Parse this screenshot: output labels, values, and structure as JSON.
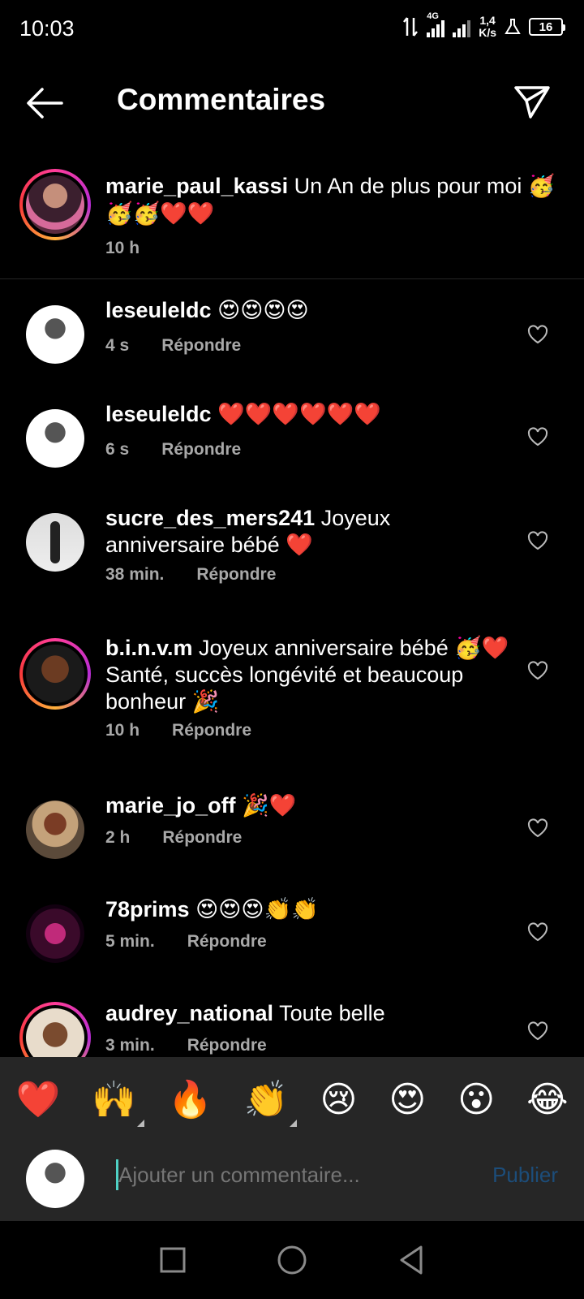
{
  "status_bar": {
    "time": "10:03",
    "network": "4G",
    "speed_value": "1,4",
    "speed_unit": "K/s",
    "battery": "16"
  },
  "header": {
    "title": "Commentaires"
  },
  "caption": {
    "username": "marie_paul_kassi",
    "text": "Un An de plus pour moi 🥳🥳🥳❤️❤️",
    "time": "10 h"
  },
  "comments": [
    {
      "username": "leseuleldc",
      "text": "😍😍😍😍",
      "time": "4 s",
      "reply": "Répondre"
    },
    {
      "username": "leseuleldc",
      "text": "❤️❤️❤️❤️❤️❤️",
      "time": "6 s",
      "reply": "Répondre"
    },
    {
      "username": "sucre_des_mers241",
      "text": "Joyeux anniversaire bébé ❤️",
      "time": "38 min.",
      "reply": "Répondre"
    },
    {
      "username": "b.i.n.v.m",
      "text": "Joyeux anniversaire bébé 🥳❤️ Santé, succès longévité et beaucoup bonheur 🎉",
      "time": "10 h",
      "reply": "Répondre"
    },
    {
      "username": "marie_jo_off",
      "text": "🎉❤️",
      "time": "2 h",
      "reply": "Répondre"
    },
    {
      "username": "78prims",
      "text": "😍😍😍👏👏",
      "time": "5 min.",
      "reply": "Répondre"
    },
    {
      "username": "audrey_national",
      "text": "Toute belle",
      "time": "3 min.",
      "reply": "Répondre"
    }
  ],
  "quick_reactions": [
    "❤️",
    "🙌",
    "🔥",
    "👏",
    "😢",
    "😍",
    "😮",
    "😂"
  ],
  "composer": {
    "placeholder": "Ajouter un commentaire...",
    "publish_label": "Publier"
  }
}
